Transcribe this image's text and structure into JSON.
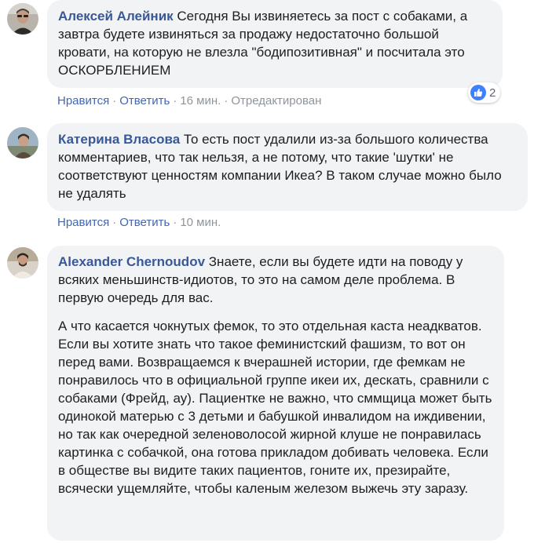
{
  "comments": [
    {
      "author": "Алексей Алейник",
      "text": "Сегодня Вы извиняетесь за пост с собаками, а завтра будете извиняться за продажу недостаточно большой кровати, на которую не влезла \"бодипозитивная\" и посчитала это ОСКОРБЛЕНИЕМ",
      "like_label": "Нравится",
      "reply_label": "Ответить",
      "time": "16 мин.",
      "edited": "Отредактирован",
      "reaction_count": "2"
    },
    {
      "author": "Катерина Власова",
      "text": "То есть пост удалили из-за большого количества комментариев, что так нельзя, а не потому, что такие 'шутки' не соответствуют ценностям компании Икеа? В таком случае можно было не удалять",
      "like_label": "Нравится",
      "reply_label": "Ответить",
      "time": "10 мин."
    },
    {
      "author": "Alexander Chernoudov",
      "text": "Знаете, если вы будете идти на поводу у всяких меньшинств-идиотов, то это на самом деле проблема. В первую очередь для вас.",
      "text2": "А что касается чокнутых фемок, то это отдельная каста неадкватов. Если вы хотите знать что такое феминистский фашизм, то вот он перед вами. Возвращаемся к вчерашней истории, где фемкам не понравилось что в официальной группе икеи их, дескать, сравнили с собаками (Фрейд, ау). Пациентке не важно, что сммщица может быть одинокой матерью с 3 детьми и бабушкой инвалидом на иждивении, но так как очередной зеленоволосой жирной клуше не понравилась картинка с собачкой, она готова прикладом добивать человека. Если в обществе вы видите таких пациентов, гоните их, презирайте, всячески ущемляйте, чтобы каленым железом выжечь эту заразу."
    }
  ],
  "colors": {
    "author": "#385898",
    "link": "#4267b2",
    "meta": "#90949c",
    "bubble": "#f2f3f5",
    "like_badge": "#4080ff"
  },
  "icons": {
    "reaction": "like-icon"
  }
}
